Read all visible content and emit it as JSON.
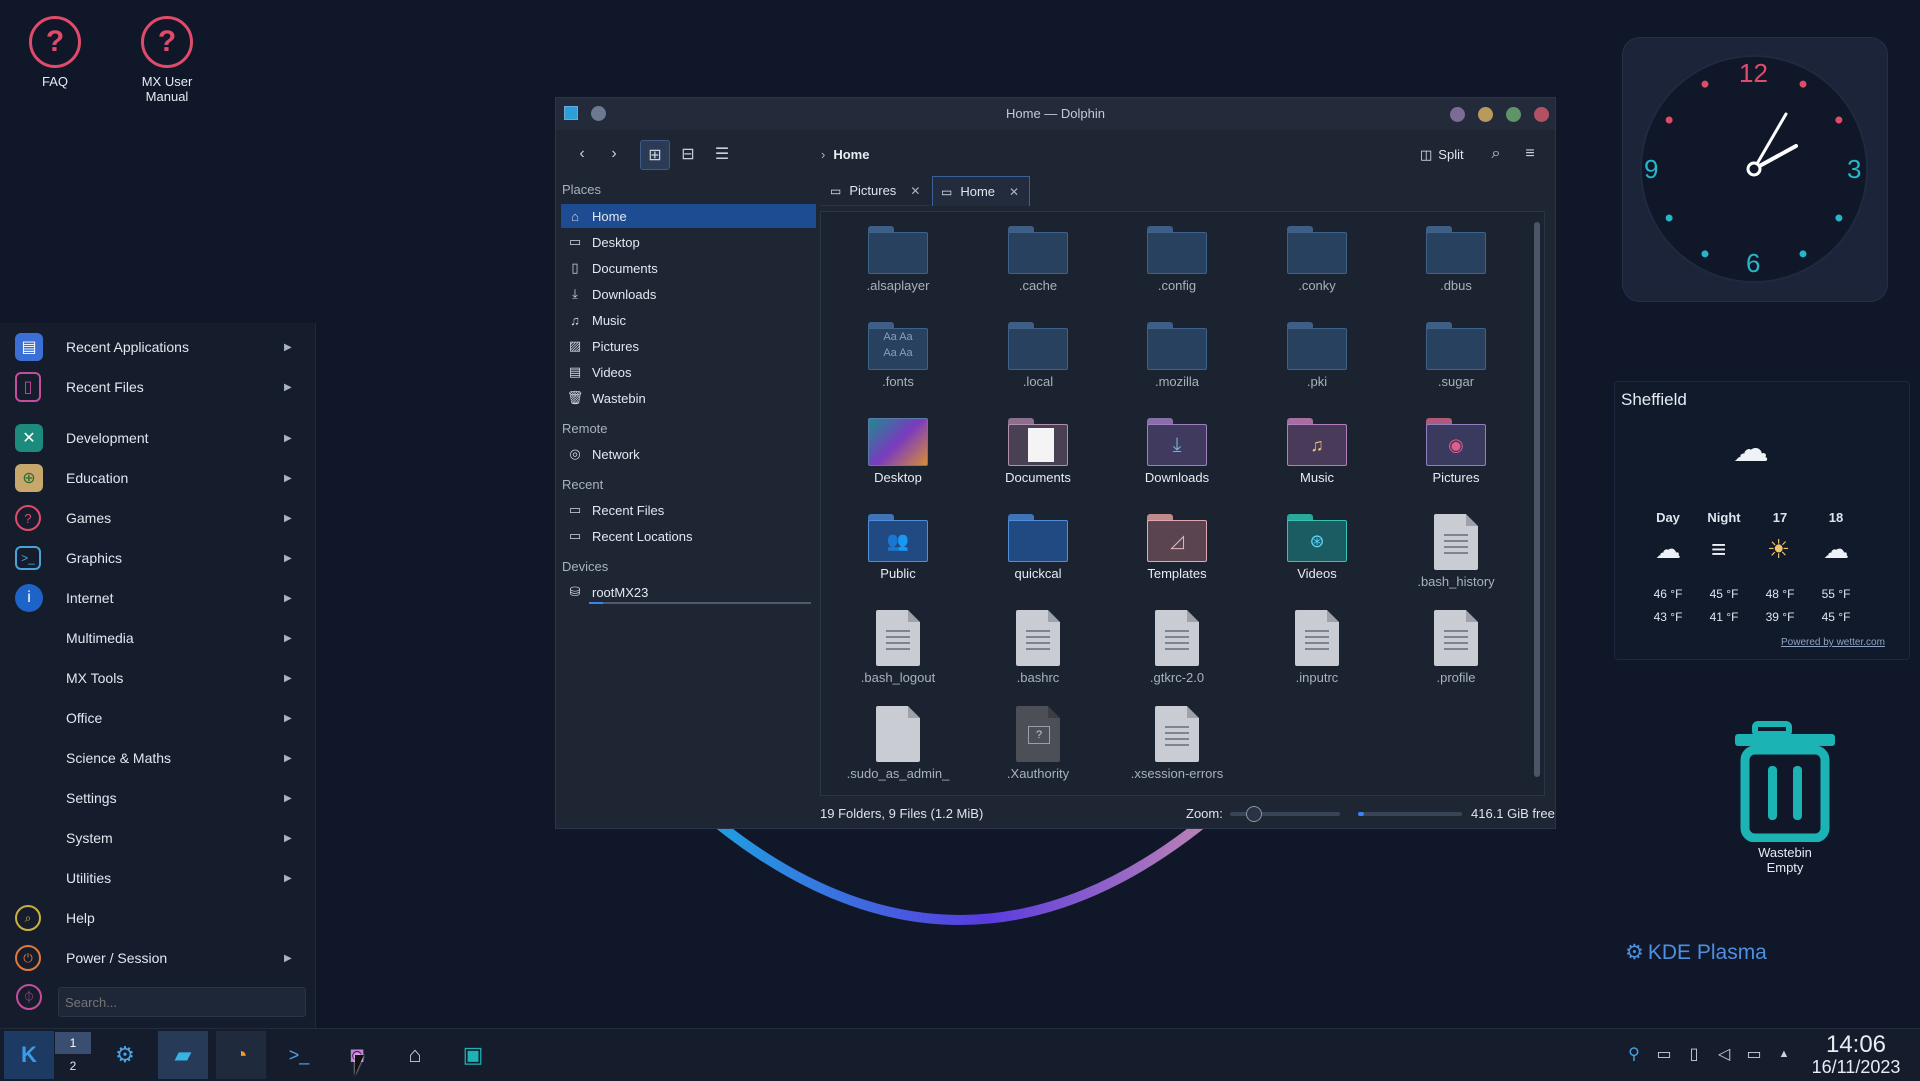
{
  "desktop": {
    "icons": [
      {
        "label": "FAQ"
      },
      {
        "label_line1": "MX User",
        "label_line2": "Manual"
      }
    ]
  },
  "app_menu": {
    "items": [
      {
        "label": "Recent Applications"
      },
      {
        "label": "Recent Files"
      },
      {
        "label": "Development"
      },
      {
        "label": "Education"
      },
      {
        "label": "Games"
      },
      {
        "label": "Graphics"
      },
      {
        "label": "Internet"
      },
      {
        "label": "Multimedia"
      },
      {
        "label": "MX Tools"
      },
      {
        "label": "Office"
      },
      {
        "label": "Science & Maths"
      },
      {
        "label": "Settings"
      },
      {
        "label": "System"
      },
      {
        "label": "Utilities"
      },
      {
        "label": "Help"
      },
      {
        "label": "Power / Session"
      }
    ],
    "search_placeholder": "Search..."
  },
  "dolphin": {
    "title": "Home — Dolphin",
    "breadcrumb": "Home",
    "split_label": "Split",
    "places": {
      "places_heading": "Places",
      "items": [
        "Home",
        "Desktop",
        "Documents",
        "Downloads",
        "Music",
        "Pictures",
        "Videos",
        "Wastebin"
      ],
      "remote_heading": "Remote",
      "remote_items": [
        "Network"
      ],
      "recent_heading": "Recent",
      "recent_items": [
        "Recent Files",
        "Recent Locations"
      ],
      "devices_heading": "Devices",
      "device_items": [
        "rootMX23"
      ]
    },
    "tabs": [
      "Pictures",
      "Home"
    ],
    "files": [
      ".alsaplayer",
      ".cache",
      ".config",
      ".conky",
      ".dbus",
      ".fonts",
      ".local",
      ".mozilla",
      ".pki",
      ".sugar",
      "Desktop",
      "Documents",
      "Downloads",
      "Music",
      "Pictures",
      "Public",
      "quickcal",
      "Templates",
      "Videos",
      ".bash_history",
      ".bash_logout",
      ".bashrc",
      ".gtkrc-2.0",
      ".inputrc",
      ".profile",
      ".sudo_as_admin_",
      ".Xauthority",
      ".xsession-errors"
    ],
    "status": {
      "summary": "19 Folders, 9 Files (1.2 MiB)",
      "zoom_label": "Zoom:",
      "free_space": "416.1 GiB free"
    }
  },
  "clock": {
    "n12": "12",
    "n3": "3",
    "n6": "6",
    "n9": "9"
  },
  "weather": {
    "location": "Sheffield",
    "columns": [
      {
        "head": "Day",
        "high": "46 °F",
        "low": "43 °F"
      },
      {
        "head": "Night",
        "high": "45 °F",
        "low": "41 °F"
      },
      {
        "head": "17",
        "high": "48 °F",
        "low": "39 °F"
      },
      {
        "head": "18",
        "high": "55 °F",
        "low": "45 °F"
      }
    ],
    "credit": "Powered by wetter.com"
  },
  "wastebin": {
    "line1": "Wastebin",
    "line2": "Empty"
  },
  "kde_brand": "KDE Plasma",
  "taskbar": {
    "desktop_1": "1",
    "desktop_2": "2",
    "time": "14:06",
    "date": "16/11/2023"
  },
  "colors": {
    "accent": "#1d4c93",
    "background": "#0f1729",
    "clock_red": "#e04b6a",
    "clock_teal": "#27b5c9"
  }
}
